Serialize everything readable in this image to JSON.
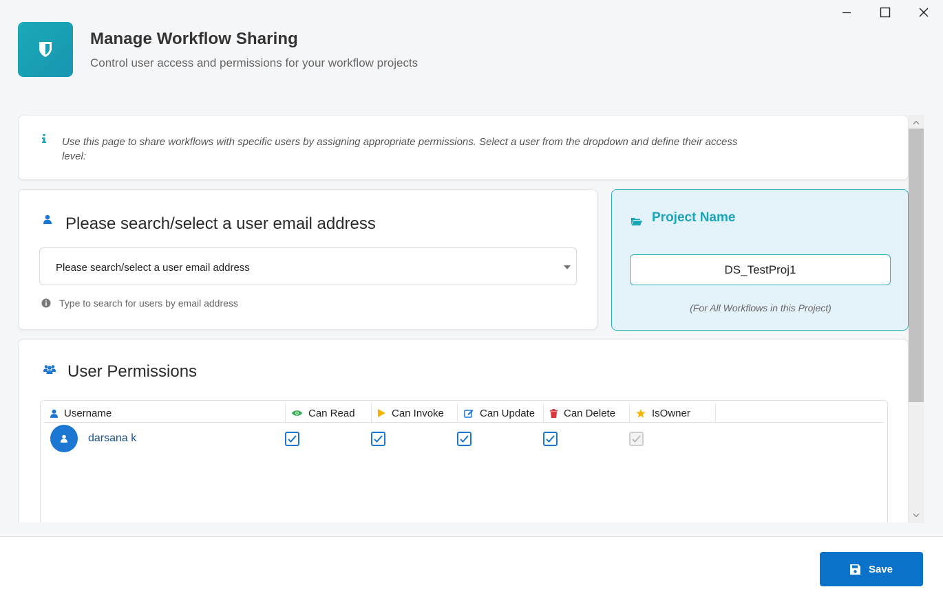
{
  "window": {
    "controls": [
      "minimize",
      "maximize",
      "close"
    ]
  },
  "header": {
    "title": "Manage Workflow Sharing",
    "subtitle": "Control user access and permissions for your workflow projects",
    "logo_icon": "shield-icon"
  },
  "info": {
    "icon": "info-icon",
    "text": "Use this page to share workflows with specific users by assigning appropriate permissions. Select a user from the dropdown and define their access level:"
  },
  "user_select": {
    "heading": "Please search/select a user email address",
    "placeholder": "Please search/select a user email address",
    "hint": "Type to search for users by email address"
  },
  "project": {
    "heading": "Project Name",
    "name": "DS_TestProj1",
    "note": "(For All Workflows in this Project)"
  },
  "permissions": {
    "heading": "User Permissions",
    "columns": [
      {
        "label": "Username",
        "icon": "user-icon"
      },
      {
        "label": "Can Read",
        "icon": "eye-icon"
      },
      {
        "label": "Can Invoke",
        "icon": "play-icon"
      },
      {
        "label": "Can Update",
        "icon": "edit-icon"
      },
      {
        "label": "Can Delete",
        "icon": "trash-icon"
      },
      {
        "label": "IsOwner",
        "icon": "star-icon"
      }
    ],
    "rows": [
      {
        "username": "darsana k",
        "can_read": true,
        "can_invoke": true,
        "can_update": true,
        "can_delete": true,
        "is_owner": true,
        "is_owner_disabled": true
      }
    ]
  },
  "footer": {
    "save_label": "Save"
  },
  "colors": {
    "accent": "#1aa6b7",
    "primary": "#0a73c9"
  }
}
